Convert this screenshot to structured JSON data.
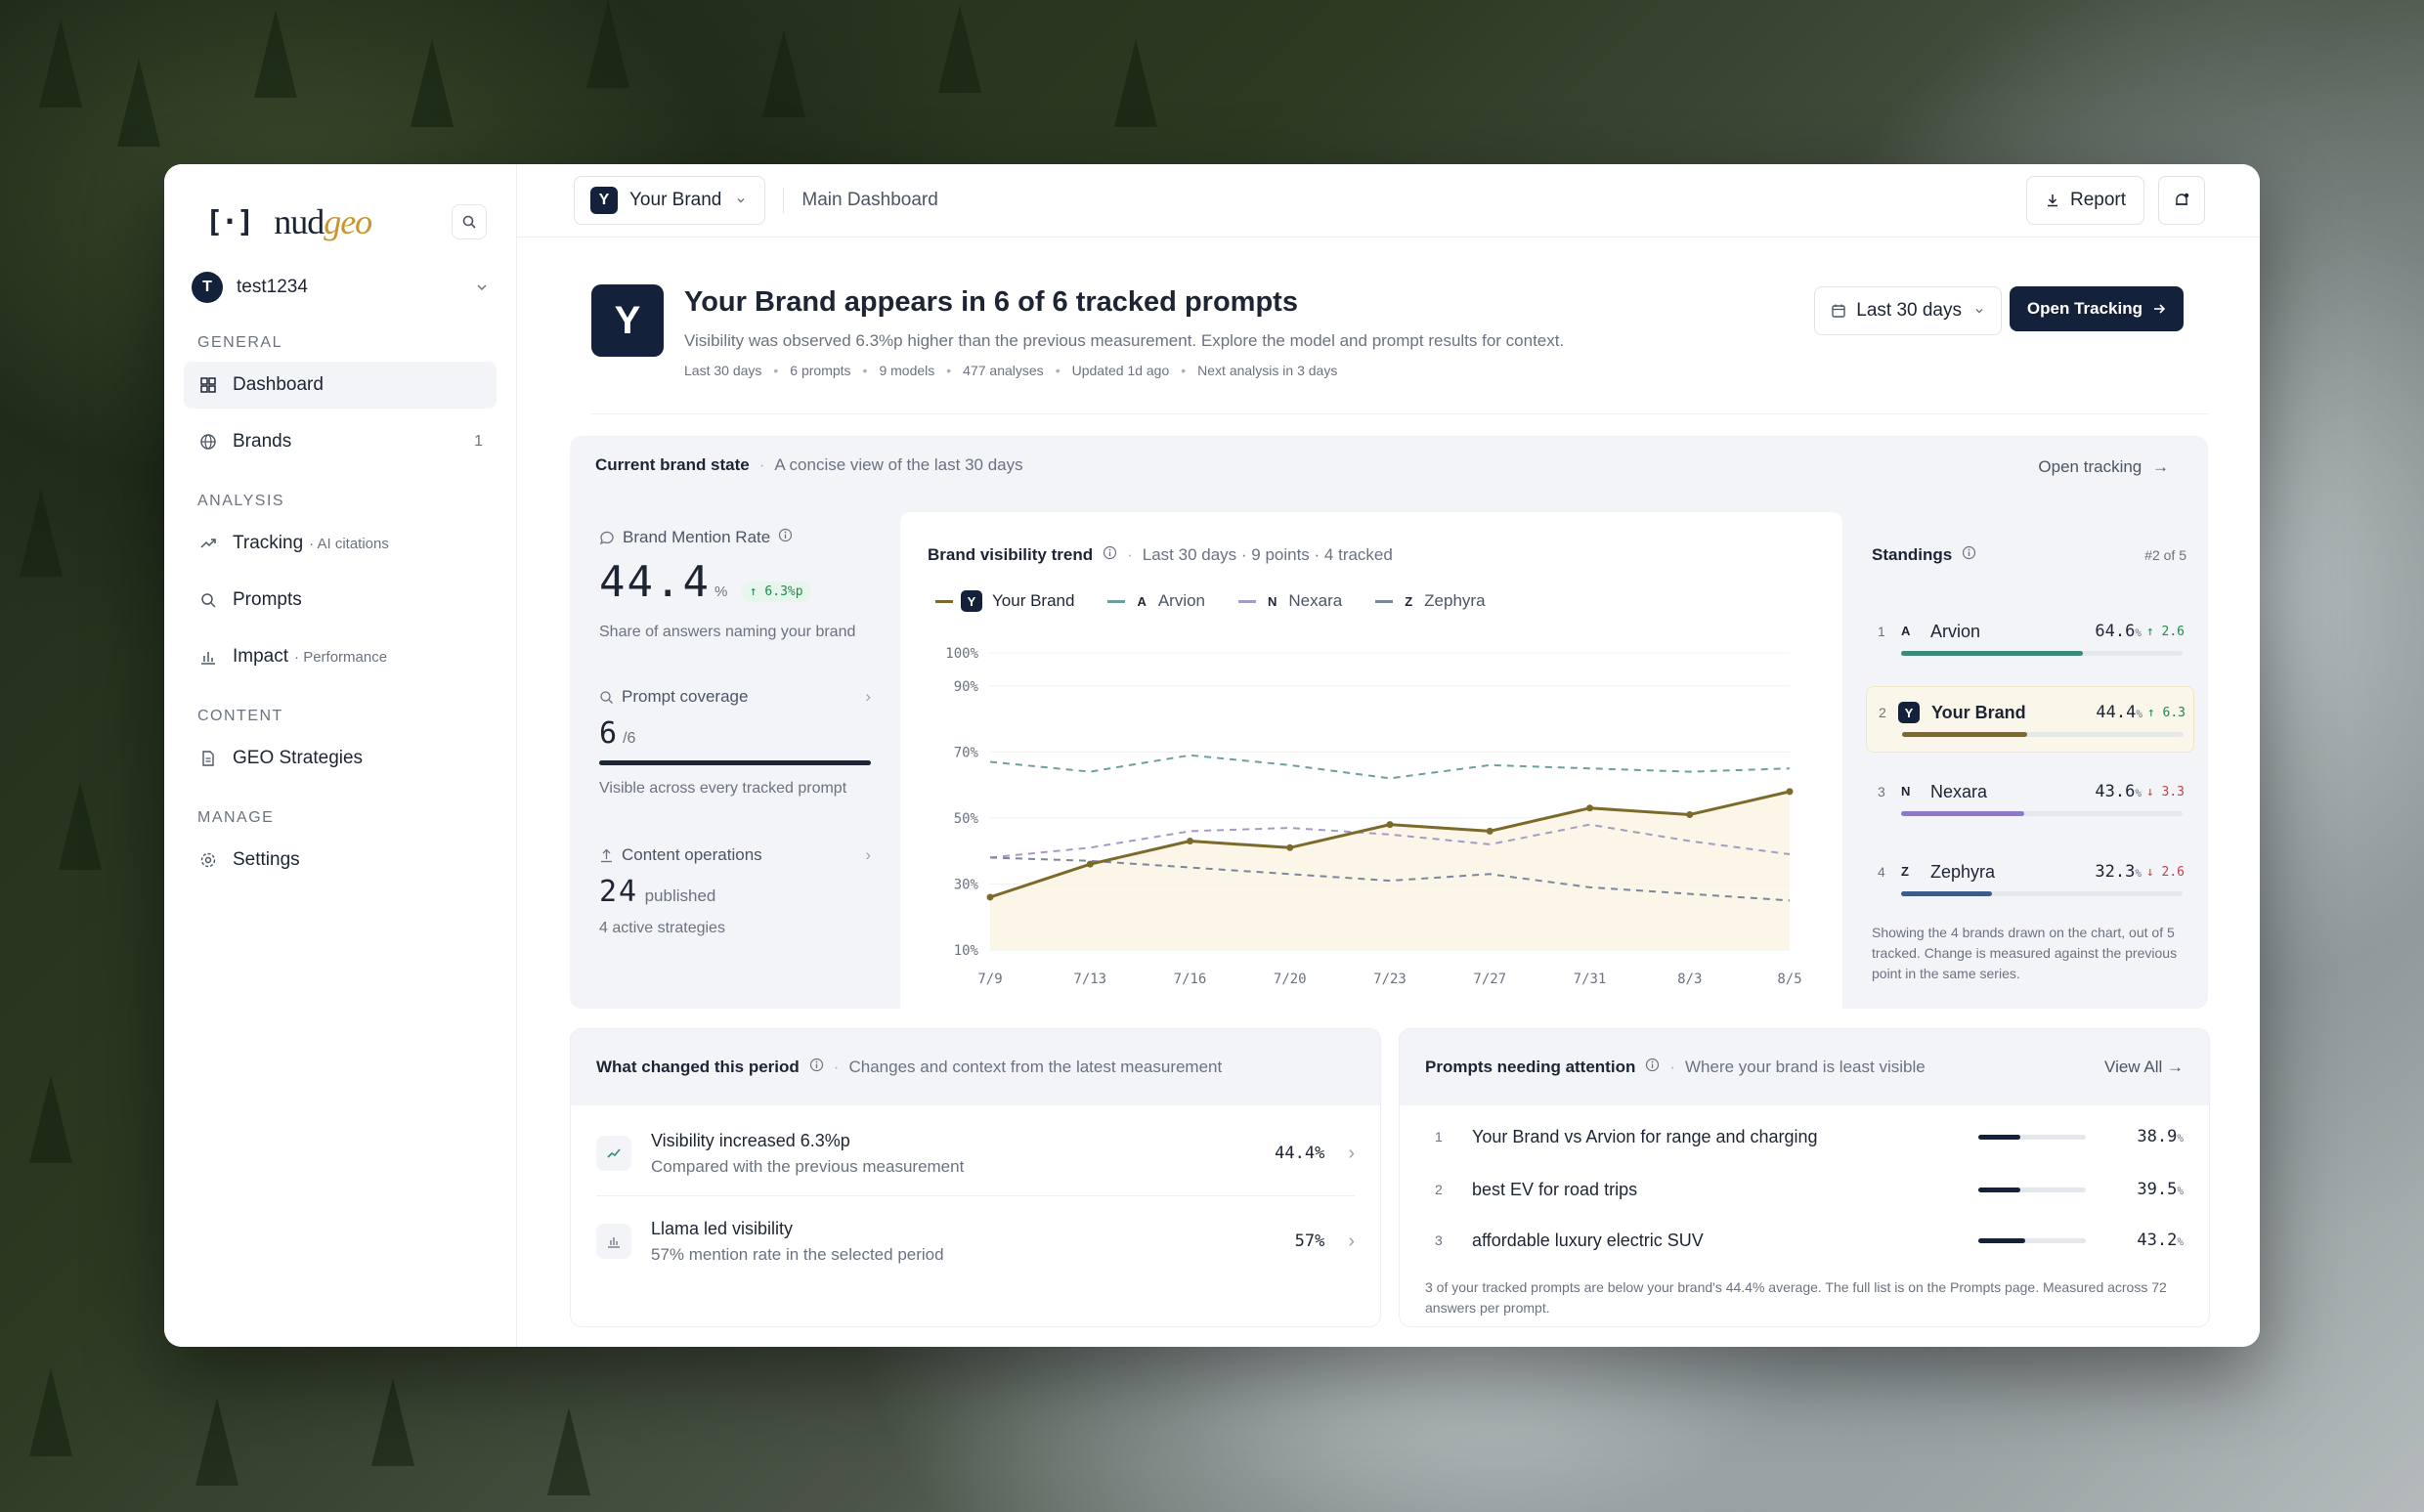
{
  "sidebar": {
    "logo_mark": "[·]",
    "logo_text_a": "nud",
    "logo_text_b": "geo",
    "workspace": {
      "avatar": "T",
      "name": "test1234"
    },
    "sections": {
      "general": "GENERAL",
      "analysis": "ANALYSIS",
      "content": "CONTENT",
      "manage": "MANAGE"
    },
    "items": {
      "dashboard": "Dashboard",
      "brands": "Brands",
      "brands_count": "1",
      "tracking": "Tracking",
      "tracking_sub": "· AI citations",
      "prompts": "Prompts",
      "impact": "Impact",
      "impact_sub": "· Performance",
      "geo": "GEO Strategies",
      "settings": "Settings"
    }
  },
  "topbar": {
    "brand_letter": "Y",
    "brand_label": "Your Brand",
    "breadcrumb": "Main Dashboard",
    "report": "Report"
  },
  "hero": {
    "logo": "Y",
    "title": "Your Brand appears in 6 of 6 tracked prompts",
    "desc": "Visibility was observed 6.3%p higher than the previous measurement. Explore the model and prompt results for context.",
    "meta": [
      "Last 30 days",
      "6 prompts",
      "9 models",
      "477 analyses",
      "Updated 1d ago",
      "Next analysis in 3 days"
    ],
    "range": "Last 30 days",
    "open": "Open Tracking"
  },
  "state": {
    "title": "Current brand state",
    "subtitle": "A concise view of the last 30 days",
    "open_link": "Open tracking",
    "mention": {
      "label": "Brand Mention Rate",
      "value": "44.4",
      "unit": "%",
      "chip": "↑ 6.3%p",
      "sub": "Share of answers naming your brand"
    },
    "coverage": {
      "label": "Prompt coverage",
      "value": "6",
      "denom": "/6",
      "progress": 1.0,
      "sub": "Visible across every tracked prompt"
    },
    "content": {
      "label": "Content operations",
      "value": "24",
      "unit": "published",
      "sub": "4 active strategies"
    }
  },
  "chart": {
    "title": "Brand visibility trend",
    "subtitle": "Last 30 days · 9 points · 4 tracked"
  },
  "chart_data": {
    "type": "line",
    "x": [
      "7/9",
      "7/13",
      "7/16",
      "7/20",
      "7/23",
      "7/27",
      "7/31",
      "8/3",
      "8/5"
    ],
    "yticks": [
      "100%",
      "90%",
      "70%",
      "50%",
      "30%",
      "10%"
    ],
    "ylim": [
      10,
      100
    ],
    "series": [
      {
        "name": "Your Brand",
        "letter": "Y",
        "color": "#7c6a2a",
        "values": [
          26,
          36,
          43,
          41,
          48,
          46,
          53,
          51,
          58
        ]
      },
      {
        "name": "Arvion",
        "letter": "A",
        "color": "#6e9fa0",
        "values": [
          67,
          64,
          69,
          66,
          62,
          66,
          65,
          64,
          65
        ]
      },
      {
        "name": "Nexara",
        "letter": "N",
        "color": "#a79ac6",
        "values": [
          38,
          41,
          46,
          47,
          45,
          42,
          48,
          43,
          39
        ]
      },
      {
        "name": "Zephyra",
        "letter": "Z",
        "color": "#7b879c",
        "values": [
          38,
          37,
          35,
          33,
          31,
          33,
          29,
          27,
          25
        ]
      }
    ]
  },
  "standings": {
    "title": "Standings",
    "rank": "#2 of 5",
    "rows": [
      {
        "num": "1",
        "letter": "A",
        "name": "Arvion",
        "value": "64.6",
        "change": "↑ 2.6",
        "dir": "up",
        "share": 0.646,
        "color": "#3d8a7c"
      },
      {
        "num": "2",
        "letter": "Y",
        "name": "Your Brand",
        "value": "44.4",
        "change": "↑ 6.3",
        "dir": "up",
        "share": 0.444,
        "color": "#7c6a2a"
      },
      {
        "num": "3",
        "letter": "N",
        "name": "Nexara",
        "value": "43.6",
        "change": "↓ 3.3",
        "dir": "down",
        "share": 0.436,
        "color": "#8d7ac6"
      },
      {
        "num": "4",
        "letter": "Z",
        "name": "Zephyra",
        "value": "32.3",
        "change": "↓ 2.6",
        "dir": "down",
        "share": 0.323,
        "color": "#3f5c88"
      }
    ],
    "note": "Showing the 4 brands drawn on the chart, out of 5 tracked. Change is measured against the previous point in the same series."
  },
  "changes": {
    "title": "What changed this period",
    "subtitle": "Changes and context from the latest measurement",
    "rows": [
      {
        "title": "Visibility increased 6.3%p",
        "sub": "Compared with the previous measurement",
        "value": "44.4%"
      },
      {
        "title": "Llama led visibility",
        "sub": "57% mention rate in the selected period",
        "value": "57%"
      }
    ]
  },
  "attention": {
    "title": "Prompts needing attention",
    "subtitle": "Where your brand is least visible",
    "view_all": "View All",
    "rows": [
      {
        "num": "1",
        "text": "Your Brand vs Arvion for range and charging",
        "value": "38.9",
        "share": 0.389
      },
      {
        "num": "2",
        "text": "best EV for road trips",
        "value": "39.5",
        "share": 0.395
      },
      {
        "num": "3",
        "text": "affordable luxury electric SUV",
        "value": "43.2",
        "share": 0.432
      }
    ],
    "note": "3 of your tracked prompts are below your brand's 44.4% average. The full list is on the Prompts page. Measured across 72 answers per prompt."
  }
}
